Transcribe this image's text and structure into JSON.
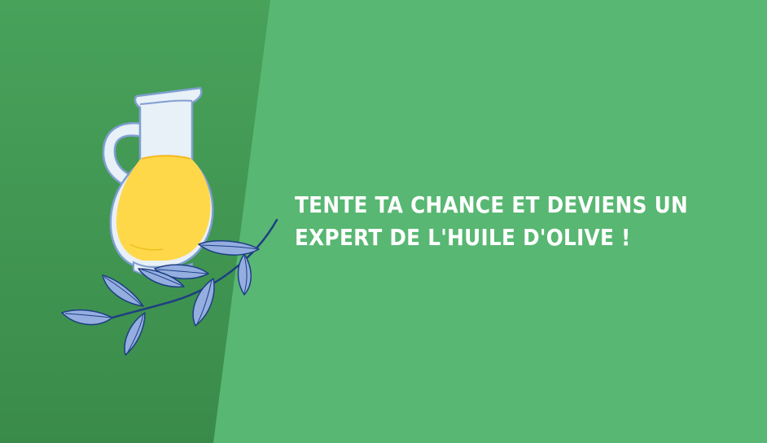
{
  "headline": {
    "line1": "TENTE TA CHANCE ET DEVIENS UN",
    "line2": "EXPERT DE L'HUILE D'OLIVE !"
  },
  "illustration": {
    "icon": "olive-oil-jug-with-olive-branch-icon"
  },
  "colors": {
    "background_light": "#56b46f",
    "background_dark": "#3c8e4b",
    "oil_yellow": "#ffd84a",
    "jug_glass": "#e8f0f8",
    "outline_blue": "#7f9fd0",
    "leaf_blue": "#94aee0",
    "branch_navy": "#1e3f82",
    "text": "#ffffff"
  }
}
